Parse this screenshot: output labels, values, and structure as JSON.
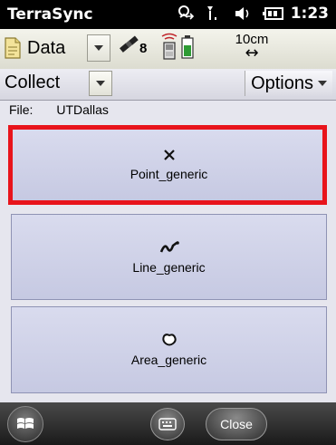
{
  "statusbar": {
    "app_title": "TerraSync",
    "time": "1:23",
    "icons": [
      "connectivity-icon",
      "signal-icon",
      "volume-icon",
      "battery-icon"
    ]
  },
  "toolbar": {
    "section_label": "Data",
    "satellite_count": "8",
    "precision_value": "10cm",
    "precision_arrow": "↔"
  },
  "subbar": {
    "mode_label": "Collect",
    "options_label": "Options"
  },
  "content": {
    "file_label": "File:",
    "file_name": "UTDallas",
    "features": [
      {
        "label": "Point_generic",
        "icon": "point-icon",
        "selected": true
      },
      {
        "label": "Line_generic",
        "icon": "line-icon",
        "selected": false
      },
      {
        "label": "Area_generic",
        "icon": "area-icon",
        "selected": false
      }
    ]
  },
  "bottombar": {
    "close_label": "Close"
  },
  "colors": {
    "highlight": "#e8141b",
    "button_fill": "#d0d3ea"
  }
}
